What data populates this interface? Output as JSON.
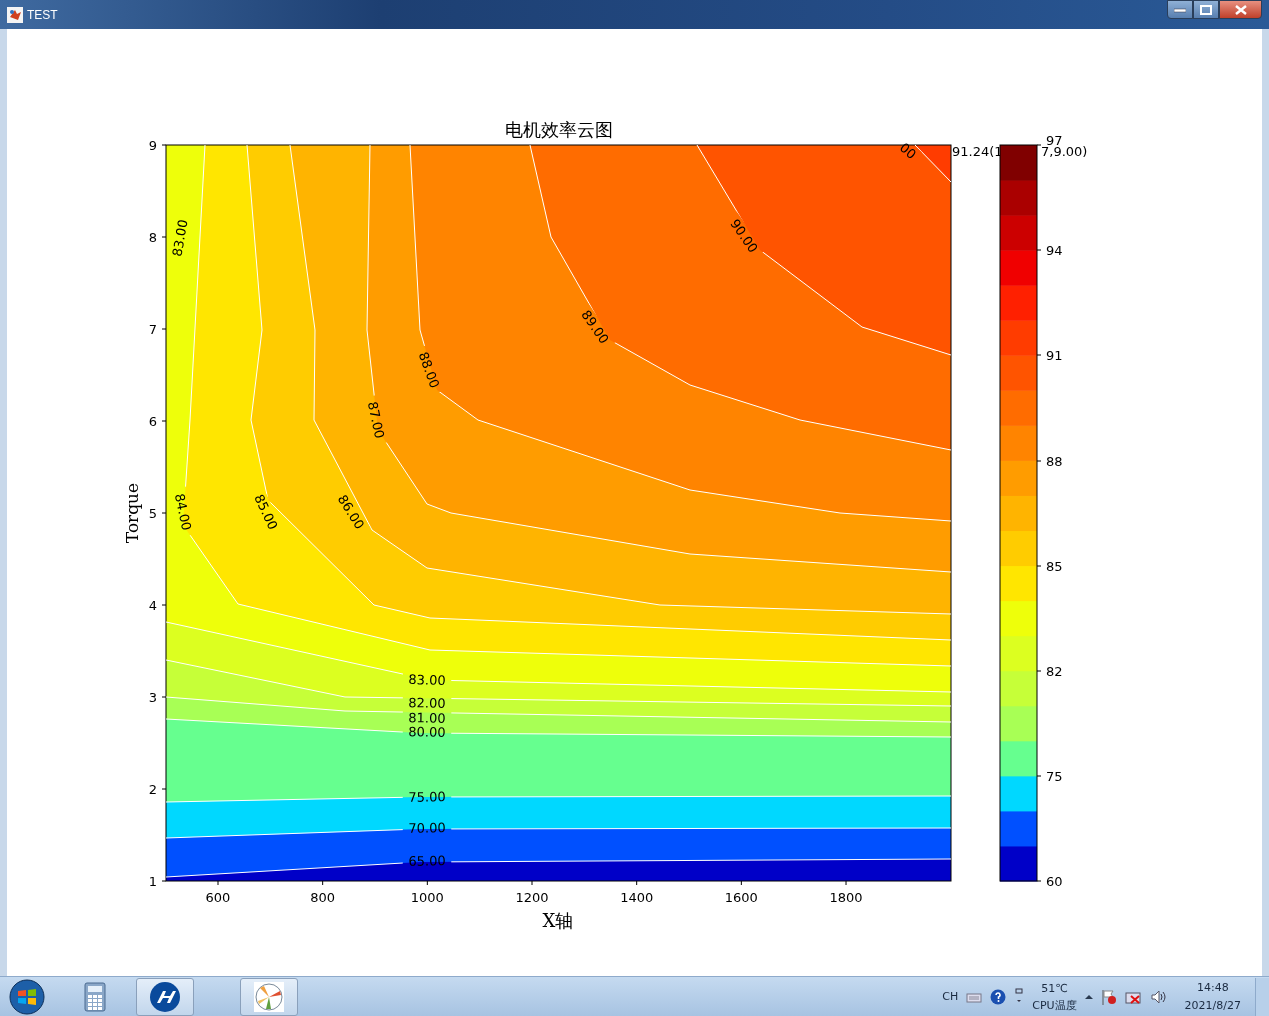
{
  "window": {
    "title": "TEST"
  },
  "chart": {
    "title": "电机效率云图",
    "xlabel": "X轴",
    "ylabel": "Torque",
    "xticks": [
      "600",
      "800",
      "1000",
      "1200",
      "1400",
      "1600",
      "1800"
    ],
    "yticks": [
      "9",
      "8",
      "7",
      "6",
      "5",
      "4",
      "3",
      "2",
      "1"
    ],
    "contour_labels": [
      "83.00",
      "84.00",
      "85.00",
      "86.00",
      "87.00",
      "88.00",
      "89.00",
      "90.00",
      "00",
      "83.00",
      "82.00",
      "81.00",
      "80.00",
      "75.00",
      "70.00",
      "65.00"
    ],
    "annotation": "91.24(1",
    "annotation_tail": "7,9.00)",
    "colorbar_ticks": [
      "97",
      "94",
      "91",
      "88",
      "85",
      "82",
      "75",
      "60"
    ]
  },
  "taskbar": {
    "language": "CH",
    "temperature": "51℃",
    "temperature_label": "CPU温度",
    "time": "14:48",
    "date": "2021/8/27"
  }
}
